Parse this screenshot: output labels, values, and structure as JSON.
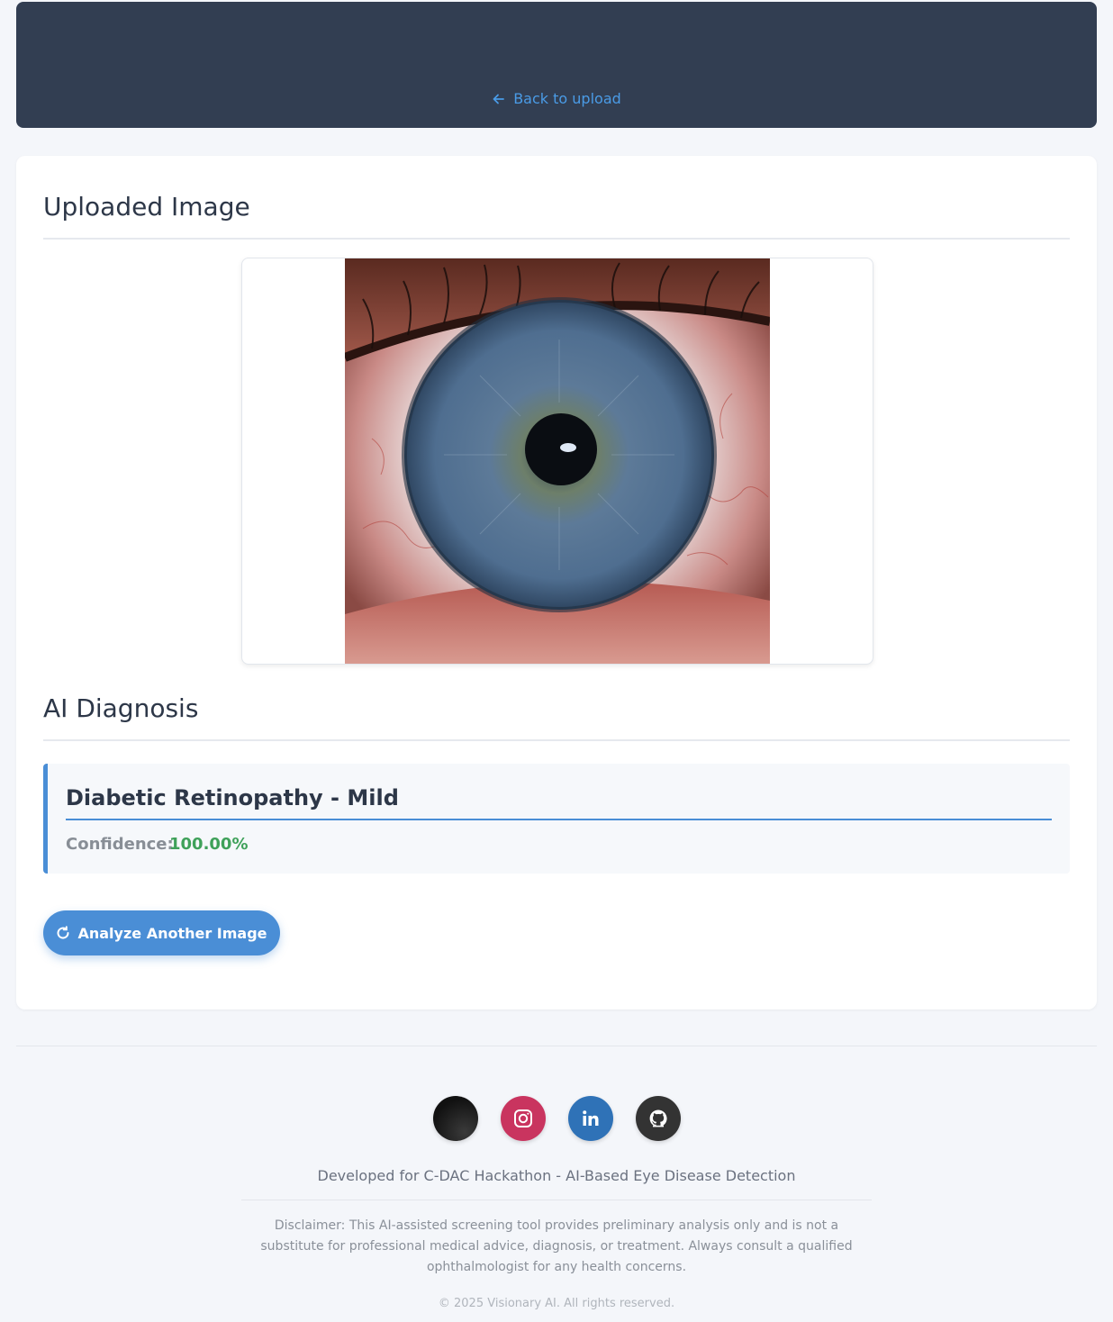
{
  "header": {
    "back_label": "Back to upload"
  },
  "uploaded": {
    "title": "Uploaded Image"
  },
  "diagnosis": {
    "title": "AI Diagnosis",
    "result": "Diabetic Retinopathy - Mild",
    "confidence_label": "Confidence:",
    "confidence_value": "100.00%"
  },
  "actions": {
    "analyze_label": "Analyze Another Image"
  },
  "footer": {
    "socials": [
      "x-icon",
      "instagram-icon",
      "linkedin-icon",
      "github-icon"
    ],
    "developed": "Developed for C-DAC Hackathon - AI-Based Eye Disease Detection",
    "disclaimer": "Disclaimer: This AI-assisted screening tool provides preliminary analysis only and is not a substitute for professional medical advice, diagnosis, or treatment. Always consult a qualified ophthalmologist for any health concerns.",
    "copyright": "© 2025 Visionary AI. All rights reserved."
  },
  "colors": {
    "header_bg": "#323e52",
    "accent": "#4a8ed6",
    "confidence": "#3fa15a"
  }
}
